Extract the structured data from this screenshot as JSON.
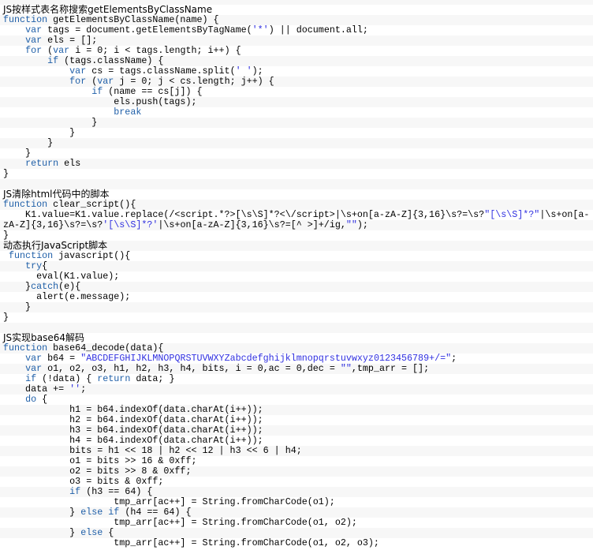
{
  "colors": {
    "keyword": "#1f5fa8",
    "string": "#3030e0",
    "stripe": "#f7f7f7"
  },
  "lines": [
    [
      [
        "h",
        "JS按样式表名称搜索getElementsByClassName"
      ]
    ],
    [
      [
        "k",
        "function"
      ],
      [
        "t",
        " getElementsByClassName(name) {"
      ]
    ],
    [
      [
        "t",
        "    "
      ],
      [
        "k",
        "var"
      ],
      [
        "t",
        " tags = document.getElementsByTagName("
      ],
      [
        "s",
        "'*'"
      ],
      [
        "t",
        ") || document.all;"
      ]
    ],
    [
      [
        "t",
        "    "
      ],
      [
        "k",
        "var"
      ],
      [
        "t",
        " els = [];"
      ]
    ],
    [
      [
        "t",
        "    "
      ],
      [
        "k",
        "for"
      ],
      [
        "t",
        " ("
      ],
      [
        "k",
        "var"
      ],
      [
        "t",
        " i = 0; i < tags.length; i++) {"
      ]
    ],
    [
      [
        "t",
        "        "
      ],
      [
        "k",
        "if"
      ],
      [
        "t",
        " (tags.className) {"
      ]
    ],
    [
      [
        "t",
        "            "
      ],
      [
        "k",
        "var"
      ],
      [
        "t",
        " cs = tags.className.split("
      ],
      [
        "s",
        "' '"
      ],
      [
        "t",
        ");"
      ]
    ],
    [
      [
        "t",
        "            "
      ],
      [
        "k",
        "for"
      ],
      [
        "t",
        " ("
      ],
      [
        "k",
        "var"
      ],
      [
        "t",
        " j = 0; j < cs.length; j++) {"
      ]
    ],
    [
      [
        "t",
        "                "
      ],
      [
        "k",
        "if"
      ],
      [
        "t",
        " (name == cs[j]) {"
      ]
    ],
    [
      [
        "t",
        "                    els.push(tags);"
      ]
    ],
    [
      [
        "t",
        "                    "
      ],
      [
        "k",
        "break"
      ]
    ],
    [
      [
        "t",
        "                }"
      ]
    ],
    [
      [
        "t",
        "            }"
      ]
    ],
    [
      [
        "t",
        "        }"
      ]
    ],
    [
      [
        "t",
        "    }"
      ]
    ],
    [
      [
        "t",
        "    "
      ],
      [
        "k",
        "return"
      ],
      [
        "t",
        " els"
      ]
    ],
    [
      [
        "t",
        "}"
      ]
    ],
    [],
    [
      [
        "h",
        "JS清除html代码中的脚本"
      ]
    ],
    [
      [
        "k",
        "function"
      ],
      [
        "t",
        " clear_script(){"
      ]
    ],
    [
      [
        "t",
        "    K1.value=K1.value.replace(/<script.*?>[\\s\\S]*?<\\/script>|\\s+on[a-zA-Z]{3,16}\\s?=\\s?"
      ],
      [
        "s",
        "\"[\\s\\S]*?\""
      ],
      [
        "t",
        "|\\s+on[a-"
      ]
    ],
    [
      [
        "t",
        "zA-Z]{3,16}\\s?=\\s?"
      ],
      [
        "s",
        "'[\\s\\S]*?'"
      ],
      [
        "t",
        "|\\s+on[a-zA-Z]{3,16}\\s?=[^ >]+/ig,"
      ],
      [
        "s",
        "\"\""
      ],
      [
        "t",
        ");"
      ]
    ],
    [
      [
        "t",
        "}"
      ]
    ],
    [
      [
        "h",
        "动态执行JavaScript脚本"
      ]
    ],
    [
      [
        "t",
        " "
      ],
      [
        "k",
        "function"
      ],
      [
        "t",
        " javascript(){"
      ]
    ],
    [
      [
        "t",
        "    "
      ],
      [
        "k",
        "try"
      ],
      [
        "t",
        "{"
      ]
    ],
    [
      [
        "t",
        "      eval(K1.value);"
      ]
    ],
    [
      [
        "t",
        "    }"
      ],
      [
        "k",
        "catch"
      ],
      [
        "t",
        "(e){"
      ]
    ],
    [
      [
        "t",
        "      alert(e.message);"
      ]
    ],
    [
      [
        "t",
        "    }"
      ]
    ],
    [
      [
        "t",
        "}"
      ]
    ],
    [],
    [
      [
        "h",
        "JS实现base64解码"
      ]
    ],
    [
      [
        "k",
        "function"
      ],
      [
        "t",
        " base64_decode(data){"
      ]
    ],
    [
      [
        "t",
        "    "
      ],
      [
        "k",
        "var"
      ],
      [
        "t",
        " b64 = "
      ],
      [
        "s",
        "\"ABCDEFGHIJKLMNOPQRSTUVWXYZabcdefghijklmnopqrstuvwxyz0123456789+/=\""
      ],
      [
        "t",
        ";"
      ]
    ],
    [
      [
        "t",
        "    "
      ],
      [
        "k",
        "var"
      ],
      [
        "t",
        " o1, o2, o3, h1, h2, h3, h4, bits, i = 0,ac = 0,dec = "
      ],
      [
        "s",
        "\"\""
      ],
      [
        "t",
        ",tmp_arr = [];"
      ]
    ],
    [
      [
        "t",
        "    "
      ],
      [
        "k",
        "if"
      ],
      [
        "t",
        " (!data) { "
      ],
      [
        "k",
        "return"
      ],
      [
        "t",
        " data; }"
      ]
    ],
    [
      [
        "t",
        "    data += "
      ],
      [
        "s",
        "''"
      ],
      [
        "t",
        ";"
      ]
    ],
    [
      [
        "t",
        "    "
      ],
      [
        "k",
        "do"
      ],
      [
        "t",
        " {"
      ]
    ],
    [
      [
        "t",
        "            h1 = b64.indexOf(data.charAt(i++));"
      ]
    ],
    [
      [
        "t",
        "            h2 = b64.indexOf(data.charAt(i++));"
      ]
    ],
    [
      [
        "t",
        "            h3 = b64.indexOf(data.charAt(i++));"
      ]
    ],
    [
      [
        "t",
        "            h4 = b64.indexOf(data.charAt(i++));"
      ]
    ],
    [
      [
        "t",
        "            bits = h1 << 18 | h2 << 12 | h3 << 6 | h4;"
      ]
    ],
    [
      [
        "t",
        "            o1 = bits >> 16 & 0xff;"
      ]
    ],
    [
      [
        "t",
        "            o2 = bits >> 8 & 0xff;"
      ]
    ],
    [
      [
        "t",
        "            o3 = bits & 0xff;"
      ]
    ],
    [
      [
        "t",
        "            "
      ],
      [
        "k",
        "if"
      ],
      [
        "t",
        " (h3 == 64) {"
      ]
    ],
    [
      [
        "t",
        "                    tmp_arr[ac++] = String.fromCharCode(o1);"
      ]
    ],
    [
      [
        "t",
        "            } "
      ],
      [
        "k",
        "else"
      ],
      [
        "t",
        " "
      ],
      [
        "k",
        "if"
      ],
      [
        "t",
        " (h4 == 64) {"
      ]
    ],
    [
      [
        "t",
        "                    tmp_arr[ac++] = String.fromCharCode(o1, o2);"
      ]
    ],
    [
      [
        "t",
        "            } "
      ],
      [
        "k",
        "else"
      ],
      [
        "t",
        " {"
      ]
    ],
    [
      [
        "t",
        "                    tmp_arr[ac++] = String.fromCharCode(o1, o2, o3);"
      ]
    ]
  ]
}
